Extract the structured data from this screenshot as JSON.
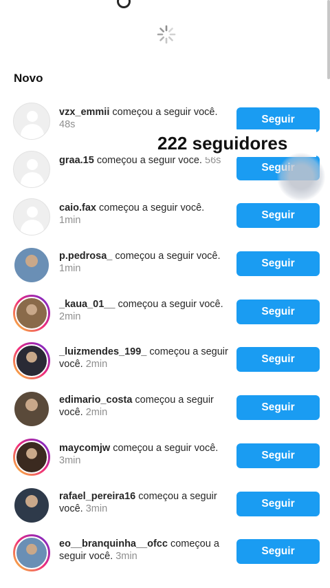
{
  "header": {
    "section_title": "Novo"
  },
  "overlay_text": "222 seguidores",
  "follow_label": "Seguir",
  "notifications": [
    {
      "username": "vzx_emmii",
      "action": "começou a seguir você.",
      "time": "48s",
      "avatar": "placeholder"
    },
    {
      "username": "graa.15",
      "action": "começou a seguir você.",
      "time": "56s",
      "avatar": "placeholder"
    },
    {
      "username": "caio.fax",
      "action": "começou a seguir você.",
      "time": "1min",
      "avatar": "placeholder"
    },
    {
      "username": "p.pedrosa_",
      "action": "começou a seguir você.",
      "time": "1min",
      "avatar": "photo"
    },
    {
      "username": "_kaua_01__",
      "action": "começou a seguir você.",
      "time": "2min",
      "avatar": "story"
    },
    {
      "username": "_luizmendes_199_",
      "action": "começou a seguir você.",
      "time": "2min",
      "avatar": "story"
    },
    {
      "username": "edimario_costa",
      "action": "começou a seguir você.",
      "time": "2min",
      "avatar": "photo"
    },
    {
      "username": "maycomjw",
      "action": "começou a seguir você.",
      "time": "3min",
      "avatar": "story"
    },
    {
      "username": "rafael_pereira16",
      "action": "começou a seguir você.",
      "time": "3min",
      "avatar": "photo"
    },
    {
      "username": "eo__branquinha__ofcc",
      "action": "começou a seguir você.",
      "time": "3min",
      "avatar": "story"
    }
  ],
  "colors": {
    "follow_button": "#1a9cf2",
    "time_text": "#8e8e8e",
    "story_ring": "#ee2a7b"
  },
  "icons": {
    "loading": "loading-spinner-icon",
    "avatar_placeholder": "person-icon"
  }
}
